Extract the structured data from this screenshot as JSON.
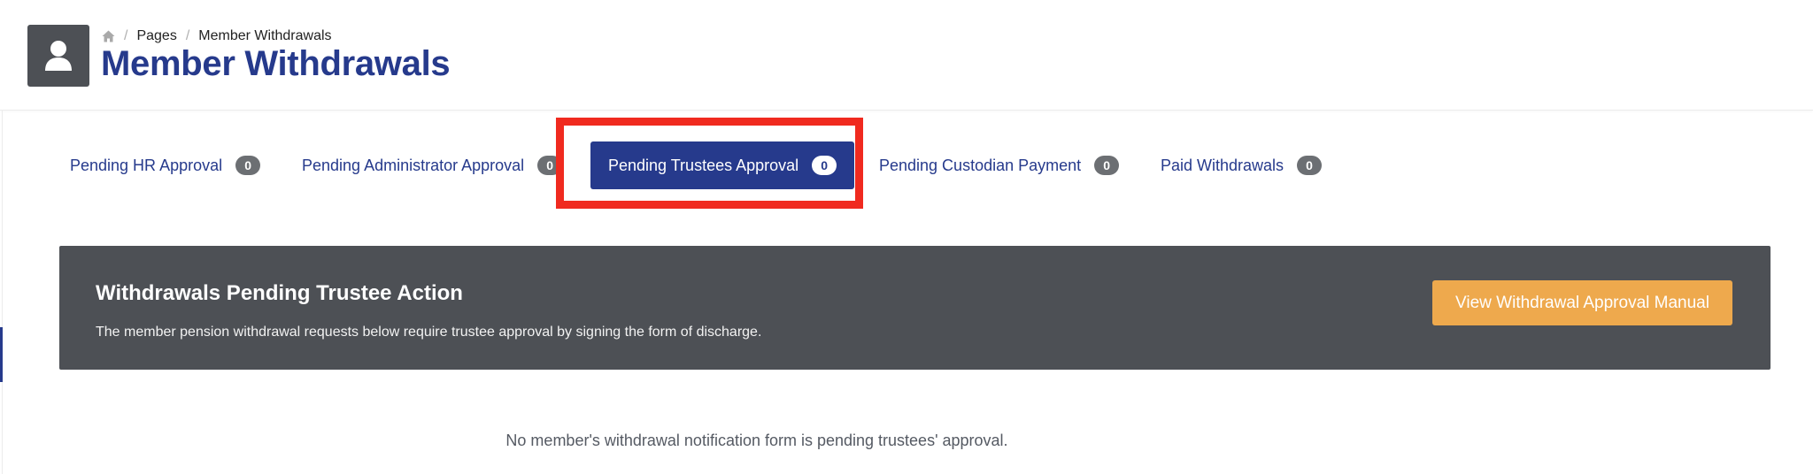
{
  "breadcrumb": {
    "home_icon": "home-icon",
    "items": [
      "Pages",
      "Member Withdrawals"
    ]
  },
  "header": {
    "icon": "user-icon",
    "title": "Member Withdrawals"
  },
  "tabs": [
    {
      "label": "Pending HR Approval",
      "count": "0",
      "active": false
    },
    {
      "label": "Pending Administrator Approval",
      "count": "0",
      "active": false
    },
    {
      "label": "Pending Trustees Approval",
      "count": "0",
      "active": true
    },
    {
      "label": "Pending Custodian Payment",
      "count": "0",
      "active": false
    },
    {
      "label": "Paid Withdrawals",
      "count": "0",
      "active": false
    }
  ],
  "panel": {
    "title": "Withdrawals Pending Trustee Action",
    "description": "The member pension withdrawal requests below require trustee approval by signing the form of discharge.",
    "button_label": "View Withdrawal Approval Manual"
  },
  "empty_message": "No member's withdrawal notification form is pending trustees' approval.",
  "colors": {
    "brand_blue": "#263a8c",
    "panel_gray": "#4d5055",
    "button_orange": "#eea94d",
    "highlight_red": "#f02a1f"
  }
}
